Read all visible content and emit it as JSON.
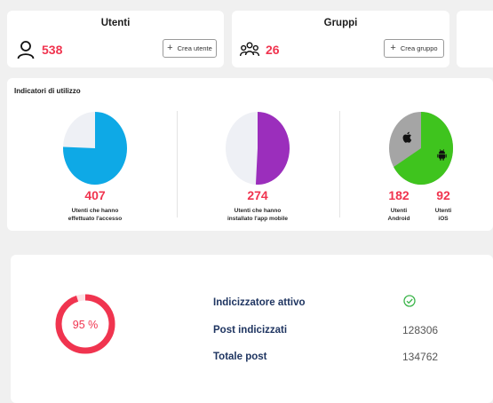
{
  "users_card": {
    "title": "Utenti",
    "count": "538",
    "button_label": "Crea utente",
    "icon": "user-icon"
  },
  "groups_card": {
    "title": "Gruppi",
    "count": "26",
    "button_label": "Crea gruppo",
    "icon": "group-icon"
  },
  "usage": {
    "title": "Indicatori di utilizzo",
    "access": {
      "value": "407",
      "label_line1": "Utenti che hanno",
      "label_line2": "effettuato l'accesso",
      "fraction": 0.756,
      "color": "#0ea9e6"
    },
    "app": {
      "value": "274",
      "label_line1": "Utenti che hanno",
      "label_line2": "installato l'app mobile",
      "fraction": 0.509,
      "color": "#9b2ebc"
    },
    "platform": {
      "android": {
        "value": "182",
        "label_line1": "Utenti",
        "label_line2": "Android",
        "color": "#3fc41e",
        "icon": "android-icon"
      },
      "ios": {
        "value": "92",
        "label_line1": "Utenti",
        "label_line2": "iOS",
        "color": "#a5a5a5",
        "icon": "apple-icon"
      },
      "android_fraction": 0.664
    }
  },
  "indexing": {
    "percent_label": "95 %",
    "percent_value": 0.95,
    "status_label": "Indicizzatore attivo",
    "status_icon": "check-circle-icon",
    "indexed_label": "Post indicizzati",
    "indexed_value": "128306",
    "total_label": "Totale post",
    "total_value": "134762"
  },
  "colors": {
    "accent": "#f0344f",
    "pie_base": "#eef0f5",
    "navy": "#1f3561",
    "success": "#3bb54a"
  }
}
